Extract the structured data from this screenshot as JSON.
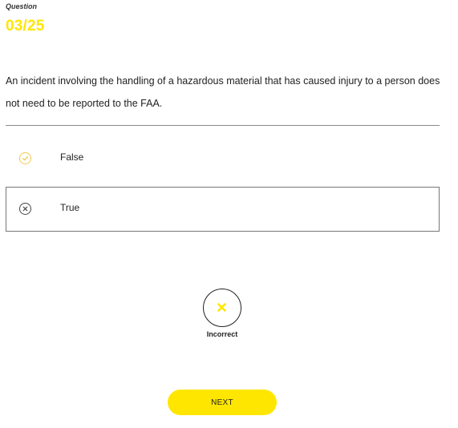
{
  "header": {
    "label": "Question",
    "counter": "03/25"
  },
  "question": {
    "text": "An incident involving the handling of a hazardous material that has caused injury to a person does not need to be reported to the FAA."
  },
  "options": [
    {
      "label": "False",
      "icon": "check-circle-icon",
      "state": "correct"
    },
    {
      "label": "True",
      "icon": "x-circle-icon",
      "state": "selected-incorrect"
    }
  ],
  "result": {
    "icon": "x-icon",
    "label": "Incorrect"
  },
  "actions": {
    "next_label": "NEXT"
  },
  "colors": {
    "accent": "#ffe600",
    "correct_ring": "#f2c94c",
    "text": "#222222"
  }
}
